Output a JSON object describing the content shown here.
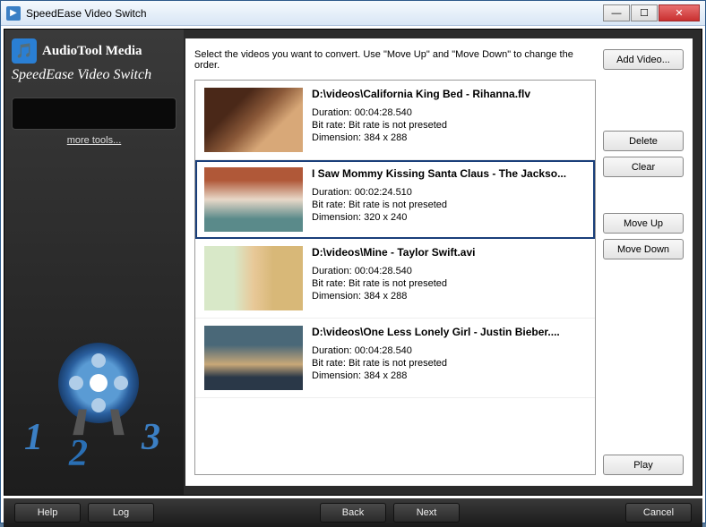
{
  "window": {
    "title": "SpeedEase Video Switch"
  },
  "brand": {
    "company": "AudioTool Media",
    "product": "SpeedEase Video Switch"
  },
  "sidebar": {
    "more_tools": "more tools..."
  },
  "main": {
    "instruction": "Select the videos you want to convert. Use \"Move Up\" and \"Move Down\" to change the order.",
    "labels": {
      "duration": "Duration:",
      "bitrate": "Bit rate:",
      "dimension": "Dimension:"
    },
    "videos": [
      {
        "title": "D:\\videos\\California King Bed - Rihanna.flv",
        "duration": "00:04:28.540",
        "bitrate": "Bit rate is not preseted",
        "dimension": "384 x 288"
      },
      {
        "title": "I Saw Mommy Kissing Santa Claus - The Jackso...",
        "duration": "00:02:24.510",
        "bitrate": "Bit rate is not preseted",
        "dimension": "320 x 240"
      },
      {
        "title": "D:\\videos\\Mine - Taylor Swift.avi",
        "duration": "00:04:28.540",
        "bitrate": "Bit rate is not preseted",
        "dimension": "384 x 288"
      },
      {
        "title": "D:\\videos\\One Less Lonely Girl - Justin Bieber....",
        "duration": "00:04:28.540",
        "bitrate": "Bit rate is not preseted",
        "dimension": "384 x 288"
      }
    ],
    "selected_index": 1
  },
  "buttons": {
    "add_video": "Add Video...",
    "delete": "Delete",
    "clear": "Clear",
    "move_up": "Move Up",
    "move_down": "Move Down",
    "play": "Play"
  },
  "footer": {
    "help": "Help",
    "log": "Log",
    "back": "Back",
    "next": "Next",
    "cancel": "Cancel"
  }
}
